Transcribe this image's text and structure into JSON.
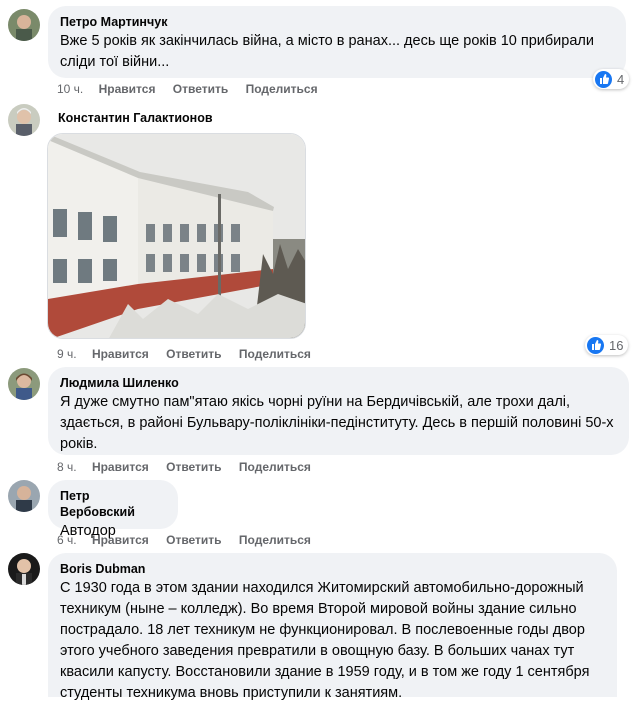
{
  "comments": [
    {
      "author": "Петро Мартинчук",
      "text": "Вже 5 років як закінчилась війна, а місто в ранах... десь ще років 10 прибирали сліди тої війни...",
      "time": "10 ч.",
      "like": "Нравится",
      "reply": "Ответить",
      "share": "Поделиться",
      "reactions": "4"
    },
    {
      "author": "Константин Галактионов",
      "time": "9 ч.",
      "like": "Нравится",
      "reply": "Ответить",
      "share": "Поделиться",
      "reactions": "16"
    },
    {
      "author": "Людмила Шиленко",
      "text": "Я дуже смутно пам\"ятаю якісь чорні руїни на Бердичівській, але трохи далі, здається, в районі Бульвару-поліклініки-педінституту. Десь в першій половині 50-х років.",
      "time": "8 ч.",
      "like": "Нравится",
      "reply": "Ответить",
      "share": "Поделиться"
    },
    {
      "author": "Петр Вербовский",
      "text": "Автодор",
      "time": "6 ч.",
      "like": "Нравится",
      "reply": "Ответить",
      "share": "Поделиться"
    },
    {
      "author": "Boris Dubman",
      "text": "С 1930 года в этом здании находился Житомирский автомобильно-дорожный техникум (ныне – колледж). Во время Второй мировой войны здание сильно пострадало. 18 лет техникум не функционировал. В послевоенные годы двор этого учебного заведения превратили в овощную базу. В больших чанах тут квасили капусту. Восстановили здание в 1959 году, и в том же году 1 сентября студенты техникума вновь приступили к занятиям."
    }
  ],
  "colors": {
    "bubble": "#f0f2f5",
    "meta": "#65676b",
    "like_blue": "#1877f2"
  },
  "icons": {
    "reaction": "like-icon"
  }
}
